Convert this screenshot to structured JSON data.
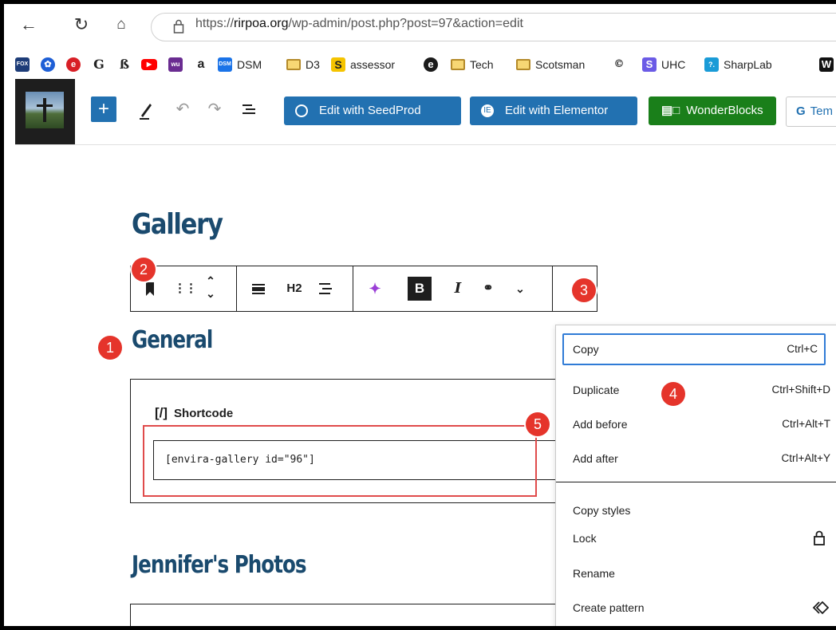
{
  "browser": {
    "url_prefix": "https://",
    "url_host": "rirpoa.org",
    "url_path": "/wp-admin/post.php?post=97&action=edit"
  },
  "bookmarks": [
    {
      "label": "",
      "icon": "fox-news-icon",
      "color": "#1d3c78"
    },
    {
      "label": "",
      "icon": "blue-flower-icon",
      "color": "#1e5fd6"
    },
    {
      "label": "",
      "icon": "red-e-icon",
      "color": "#d81f26"
    },
    {
      "label": "",
      "icon": "g-icon",
      "color": "#222222"
    },
    {
      "label": "",
      "icon": "b-icon",
      "color": "#222222"
    },
    {
      "label": "",
      "icon": "youtube-icon",
      "color": "#ff0000"
    },
    {
      "label": "",
      "icon": "wu-icon",
      "color": "#6a2c91"
    },
    {
      "label": "",
      "icon": "amazon-icon",
      "color": "#222222"
    },
    {
      "label": "DSM",
      "icon": "dsm-icon",
      "color": "#1a73e8"
    },
    {
      "label": "D3",
      "icon": "folder-icon"
    },
    {
      "label": "assessor",
      "icon": "s-icon",
      "color": "#f5c400"
    },
    {
      "label": "",
      "icon": "e-circle-icon",
      "color": "#1b1b1b"
    },
    {
      "label": "Tech",
      "icon": "folder-icon"
    },
    {
      "label": "Scotsman",
      "icon": "folder-icon"
    },
    {
      "label": "",
      "icon": "cc-icon",
      "color": "#222222"
    },
    {
      "label": "UHC",
      "icon": "s-icon",
      "color": "#6b5be6"
    },
    {
      "label": "SharpLab",
      "icon": "sharplab-icon",
      "color": "#1a9bd7"
    },
    {
      "label": "",
      "icon": "w-icon",
      "color": "#111111"
    }
  ],
  "toolbar": {
    "seedprod": "Edit with SeedProd",
    "elementor": "Edit with Elementor",
    "wonderblocks": "WonderBlocks",
    "tem": "Tem"
  },
  "editor": {
    "title": "Gallery",
    "heading_general": "General",
    "shortcode_label": "Shortcode",
    "shortcode_value": "[envira-gallery id=\"96\"]",
    "heading_jennifer": "Jennifer's Photos"
  },
  "block_toolbar": {
    "h2_label": "H2",
    "bold_label": "B",
    "italic_label": "I"
  },
  "badges": [
    "1",
    "2",
    "3",
    "4",
    "5"
  ],
  "context_menu": {
    "items": [
      {
        "label": "Copy",
        "shortcut": "Ctrl+C"
      },
      {
        "label": "Duplicate",
        "shortcut": "Ctrl+Shift+D"
      },
      {
        "label": "Add before",
        "shortcut": "Ctrl+Alt+T"
      },
      {
        "label": "Add after",
        "shortcut": "Ctrl+Alt+Y"
      },
      {
        "label": "Copy styles",
        "shortcut": ""
      },
      {
        "label": "Lock",
        "shortcut": ""
      },
      {
        "label": "Rename",
        "shortcut": ""
      },
      {
        "label": "Create pattern",
        "shortcut": ""
      }
    ]
  },
  "colors": {
    "wp_blue": "#2271b1",
    "wonder_green": "#1a7f1a",
    "heading": "#1a4a6e",
    "badge_red": "#e5342b"
  }
}
